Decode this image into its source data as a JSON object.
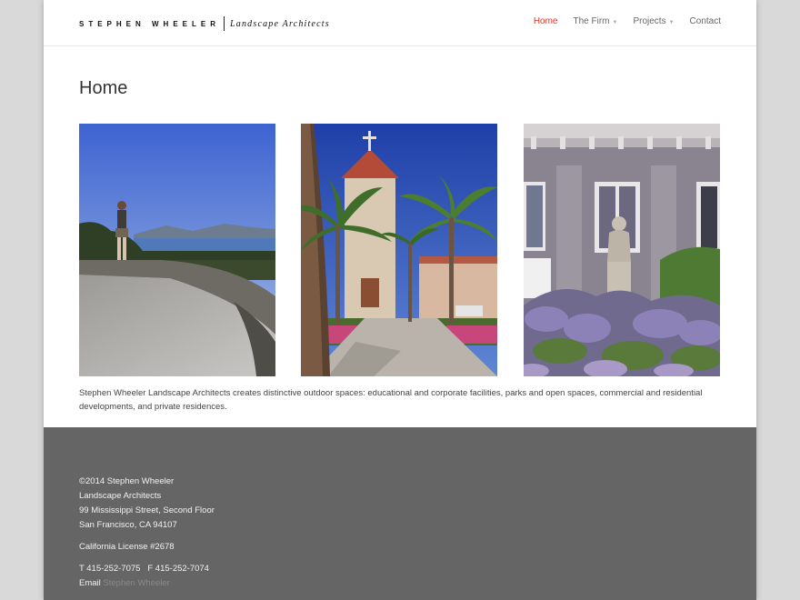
{
  "brand": {
    "name": "STEPHEN WHEELER",
    "tagline": "Landscape Architects"
  },
  "nav": {
    "items": [
      {
        "label": "Home",
        "active": true,
        "has_dropdown": false
      },
      {
        "label": "The Firm",
        "active": false,
        "has_dropdown": true
      },
      {
        "label": "Projects",
        "active": false,
        "has_dropdown": true
      },
      {
        "label": "Contact",
        "active": false,
        "has_dropdown": false
      }
    ],
    "dropdown_icon": "chevron-down-icon"
  },
  "page": {
    "title": "Home",
    "intro": "Stephen Wheeler Landscape Architects creates distinctive outdoor spaces: educational and corporate facilities, parks and open spaces, commercial and residential developments, and private residences."
  },
  "photos": [
    {
      "name": "photo-coastal-terrace"
    },
    {
      "name": "photo-palm-courtyard"
    },
    {
      "name": "photo-statue-garden"
    }
  ],
  "footer": {
    "address_lines": [
      "©2014 Stephen Wheeler",
      "Landscape Architects",
      "99 Mississippi Street, Second Floor",
      "San Francisco, CA 94107"
    ],
    "license": "California License #2678",
    "phone": "T 415-252-7075",
    "fax": "F 415-252-7074",
    "email_label": "Email",
    "email_link": "Stephen Wheeler"
  },
  "colors": {
    "accent": "#d9342b",
    "footer_bg": "#656565",
    "page_bg": "#d9d9d9"
  }
}
